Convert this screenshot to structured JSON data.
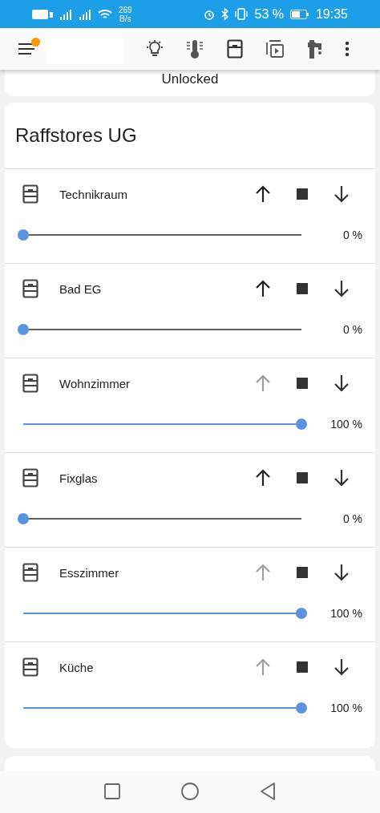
{
  "status_bar": {
    "network_speed": "269",
    "network_unit": "B/s",
    "battery": "53 %",
    "time": "19:35"
  },
  "toolbar": {
    "notification": true
  },
  "previous_card": {
    "text": "Unlocked"
  },
  "card": {
    "title": "Raffstores UG",
    "rows": [
      {
        "name": "Technikraum",
        "up_disabled": false,
        "level": 0,
        "reading": "0 %"
      },
      {
        "name": "Bad EG",
        "up_disabled": false,
        "level": 0,
        "reading": "0 %"
      },
      {
        "name": "Wohnzimmer",
        "up_disabled": true,
        "level": 1,
        "reading": "100 %"
      },
      {
        "name": "Fixglas",
        "up_disabled": false,
        "level": 0,
        "reading": "0 %"
      },
      {
        "name": "Esszimmer",
        "up_disabled": true,
        "level": 1,
        "reading": "100 %"
      },
      {
        "name": "Küche",
        "up_disabled": true,
        "level": 1,
        "reading": "100 %"
      }
    ]
  }
}
